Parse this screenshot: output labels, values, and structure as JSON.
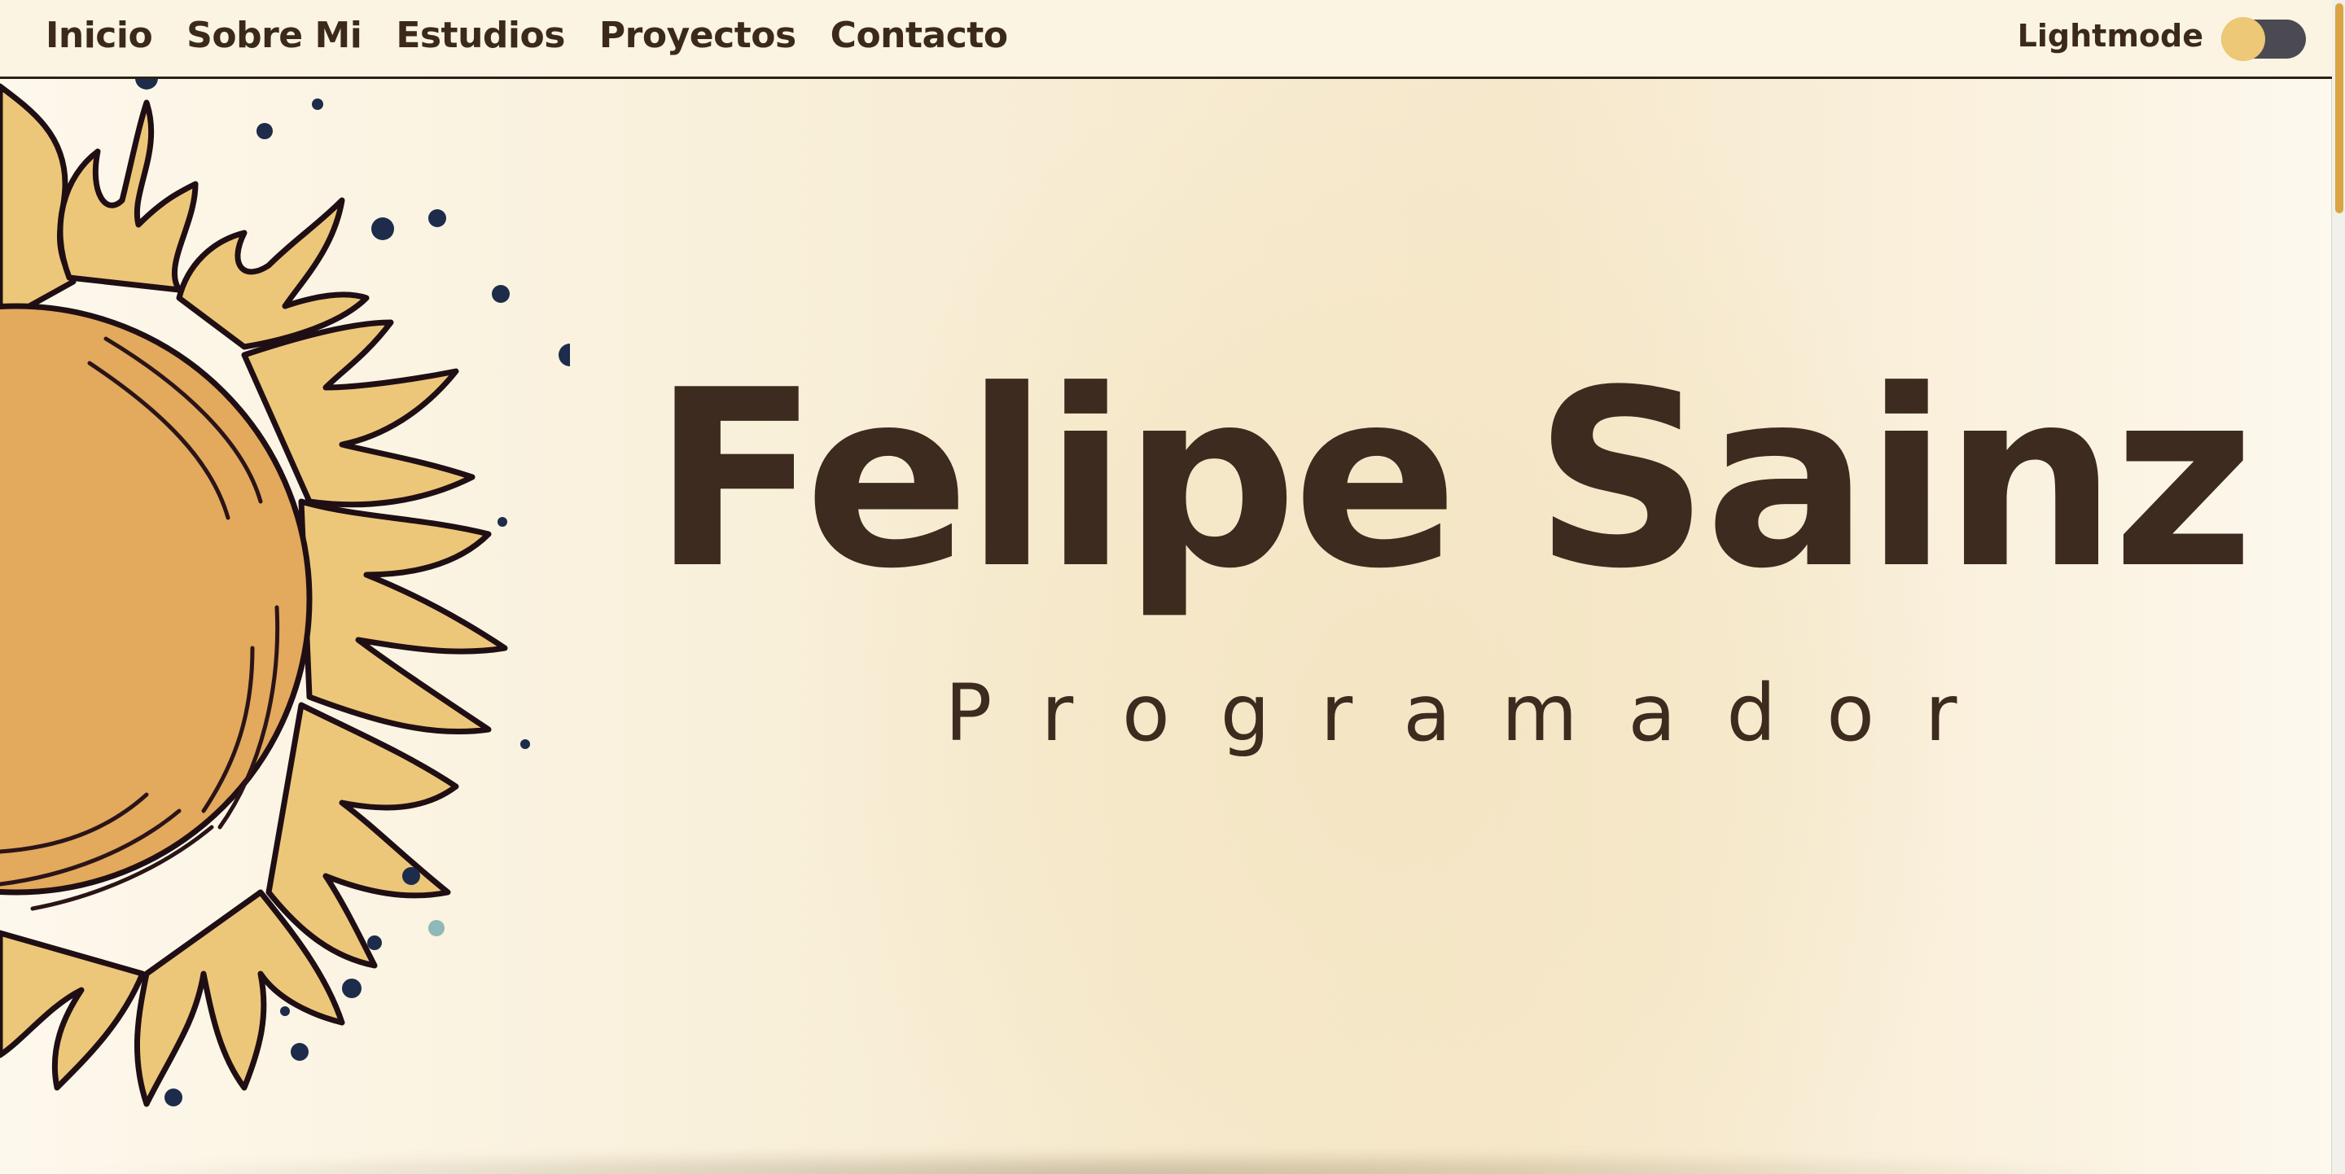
{
  "nav": {
    "items": [
      {
        "label": "Inicio"
      },
      {
        "label": "Sobre Mi"
      },
      {
        "label": "Estudios"
      },
      {
        "label": "Proyectos"
      },
      {
        "label": "Contacto"
      }
    ],
    "mode_label": "Lightmode"
  },
  "hero": {
    "name": "Felipe Sainz",
    "role": "Programador"
  },
  "colors": {
    "text": "#3d2b1f",
    "accent": "#ecc877",
    "sun_core": "#e3a95c",
    "sun_rays": "#edc779",
    "dots": "#1d2c4a"
  },
  "icons": {
    "sun": "sun-illustration-icon",
    "toggle": "theme-toggle-icon"
  }
}
